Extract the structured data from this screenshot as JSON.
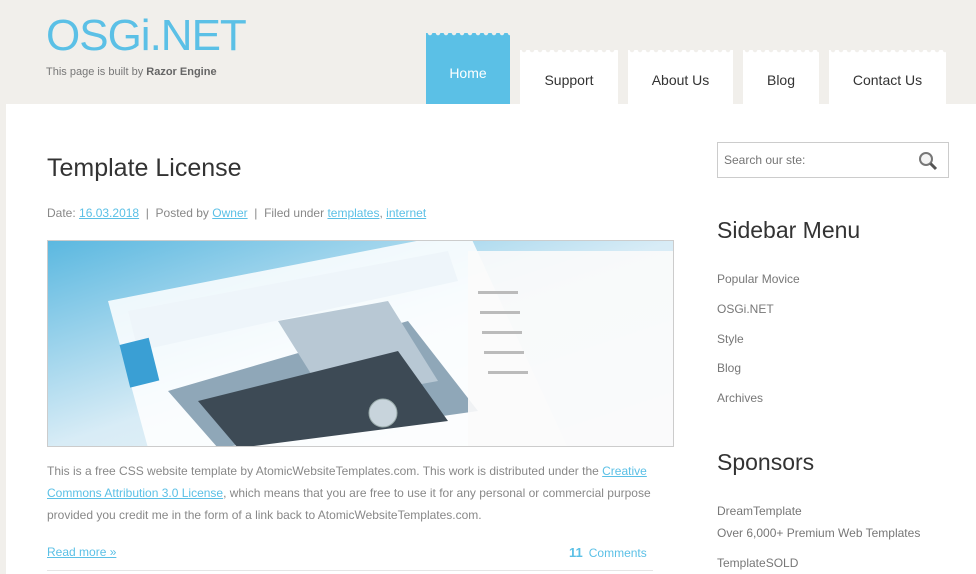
{
  "header": {
    "logo": "OSGi.NET",
    "tagline_prefix": "This page is built by",
    "tagline_bold": "Razor Engine"
  },
  "nav": [
    {
      "label": "Home",
      "active": true
    },
    {
      "label": "Support"
    },
    {
      "label": "About Us"
    },
    {
      "label": "Blog"
    },
    {
      "label": "Contact Us"
    }
  ],
  "post": {
    "title": "Template License",
    "date_label": "Date:",
    "date": "16.03.2018",
    "posted_by": "Posted by",
    "author": "Owner",
    "filed_under": "Filed under",
    "tags": [
      "templates",
      "internet"
    ],
    "body_1": "This is a free CSS website template by AtomicWebsiteTemplates.com. This work is distributed under the",
    "license_link": "Creative Commons Attribution 3.0 License",
    "body_2": ", which means that you are free to use it for any personal or commercial purpose provided you credit me in the form of a link back to AtomicWebsiteTemplates.com.",
    "read_more": "Read more »",
    "comment_count": "11",
    "comments_label": "Comments"
  },
  "sidebar": {
    "search_placeholder": "Search our ste:",
    "menu_title": "Sidebar Menu",
    "menu": [
      "Popular Movice",
      "OSGi.NET",
      "Style",
      "Blog",
      "Archives"
    ],
    "sponsors_title": "Sponsors",
    "sponsors": [
      "DreamTemplate",
      "Over 6,000+ Premium Web Templates",
      "TemplateSOLD"
    ]
  },
  "colors": {
    "accent": "#5bc0e6",
    "background": "#f1efeb"
  }
}
